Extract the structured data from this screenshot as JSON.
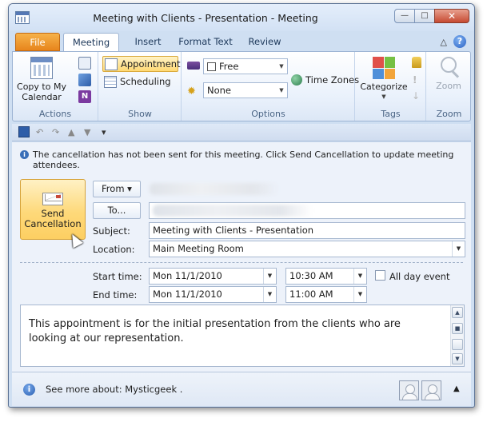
{
  "window": {
    "title": "Meeting with Clients - Presentation  -  Meeting",
    "controls": {
      "minimize": "—",
      "maximize": "□",
      "close": "✕"
    }
  },
  "tabs": [
    {
      "label": "File"
    },
    {
      "label": "Meeting"
    },
    {
      "label": "Insert"
    },
    {
      "label": "Format Text"
    },
    {
      "label": "Review"
    }
  ],
  "ribbon": {
    "help_icon": "?",
    "actions": {
      "copy_to_calendar": "Copy to My Calendar",
      "group_label": "Actions"
    },
    "show": {
      "appointment": "Appointment",
      "scheduling": "Scheduling",
      "group_label": "Show"
    },
    "options": {
      "show_as_value": "Free",
      "reminder_value": "None",
      "time_zones": "Time Zones",
      "group_label": "Options"
    },
    "tags": {
      "categorize": "Categorize",
      "group_label": "Tags"
    },
    "zoom": {
      "zoom": "Zoom",
      "group_label": "Zoom"
    }
  },
  "info_bar": {
    "text": "The cancellation has not been sent for this meeting. Click Send Cancellation to update meeting attendees."
  },
  "form": {
    "send_button": "Send Cancellation",
    "from_button": "From ▾",
    "to_button": "To...",
    "subject_label": "Subject:",
    "subject_value": "Meeting with Clients - Presentation",
    "location_label": "Location:",
    "location_value": "Main Meeting Room",
    "start_label": "Start time:",
    "start_date": "Mon 11/1/2010",
    "start_time": "10:30 AM",
    "all_day_label": "All day event",
    "end_label": "End time:",
    "end_date": "Mon 11/1/2010",
    "end_time": "11:00 AM"
  },
  "notes": {
    "body": "This appointment is for the initial presentation from the clients who are looking at our representation."
  },
  "people_pane": {
    "text": "See more about: Mysticgeek ."
  },
  "colors": {
    "file_tab": "#e7851c",
    "active_button": "#ffd974",
    "window_bg": "#cfdff2"
  }
}
